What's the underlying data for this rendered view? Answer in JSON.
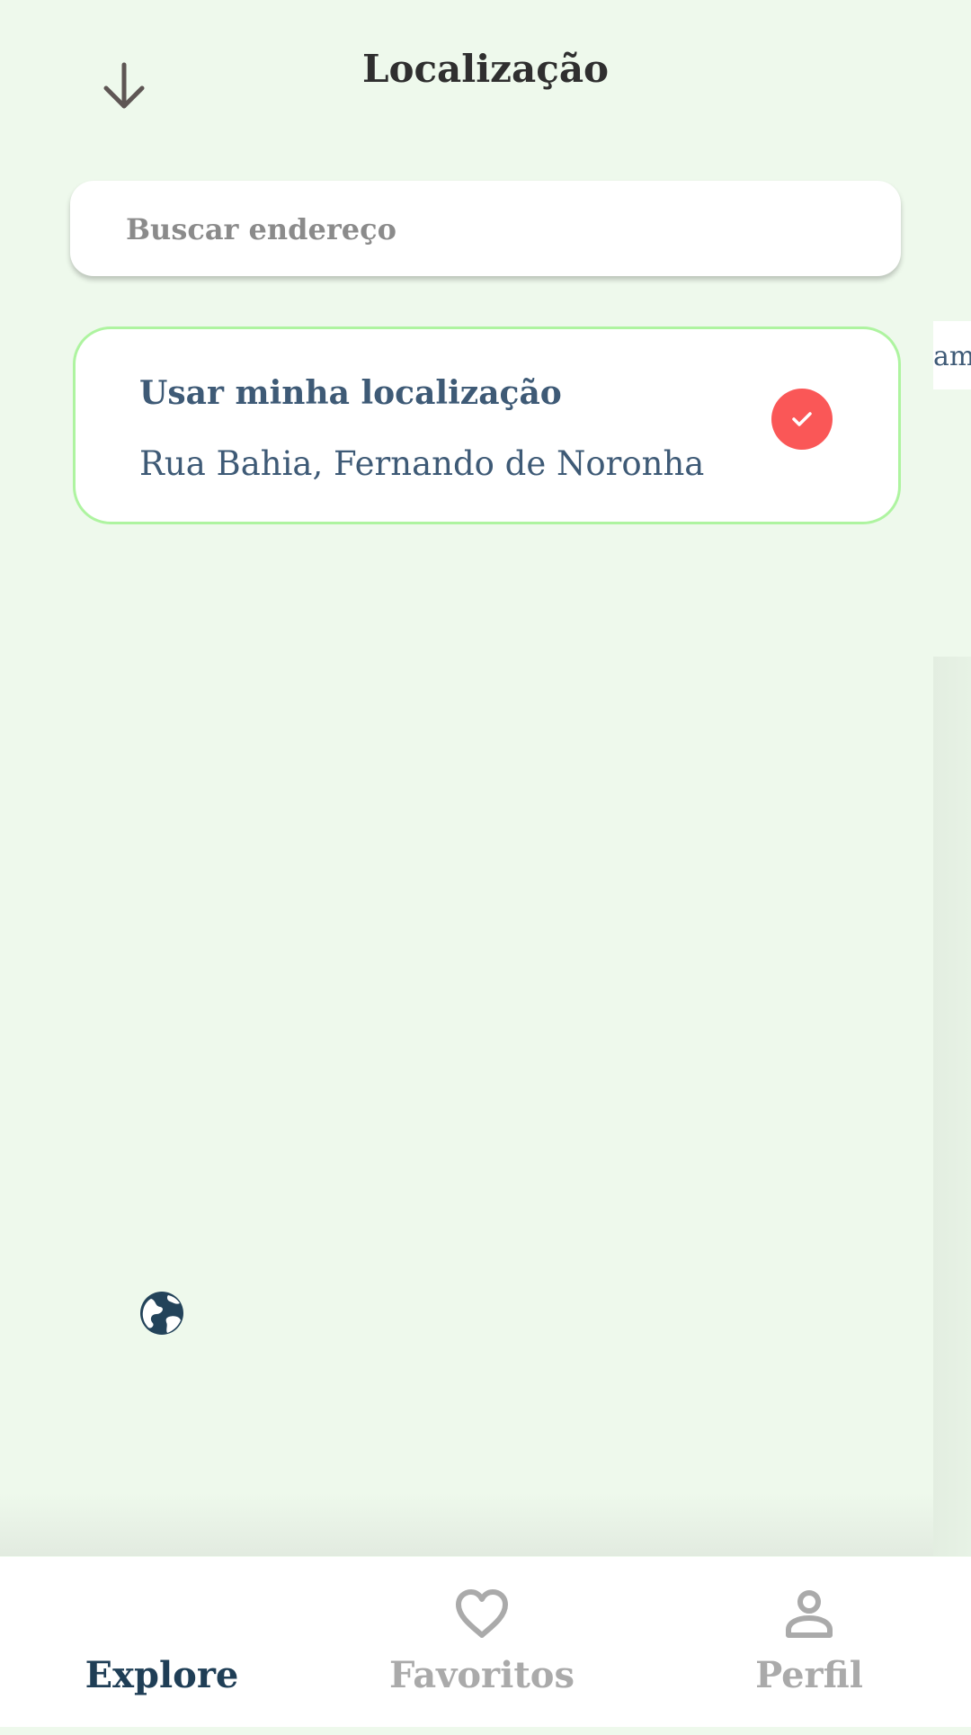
{
  "header": {
    "title": "Localização"
  },
  "search": {
    "placeholder": "Buscar endereço",
    "value": ""
  },
  "location_card": {
    "title": "Usar minha localização",
    "address": "Rua Bahia, Fernando de Noronha",
    "selected": true
  },
  "peek_card": {
    "text": "am"
  },
  "bottom_nav": {
    "items": [
      {
        "label": "Explore",
        "icon": "globe-icon",
        "active": true
      },
      {
        "label": "Favoritos",
        "icon": "heart-icon",
        "active": false
      },
      {
        "label": "Perfil",
        "icon": "person-icon",
        "active": false
      }
    ]
  },
  "colors": {
    "background": "#eef9ec",
    "accent_check": "#fa5757",
    "card_border": "#aef4a0",
    "primary_text": "#3e5a76",
    "nav_active": "#1f3e56",
    "nav_inactive": "#aaaaaa"
  }
}
